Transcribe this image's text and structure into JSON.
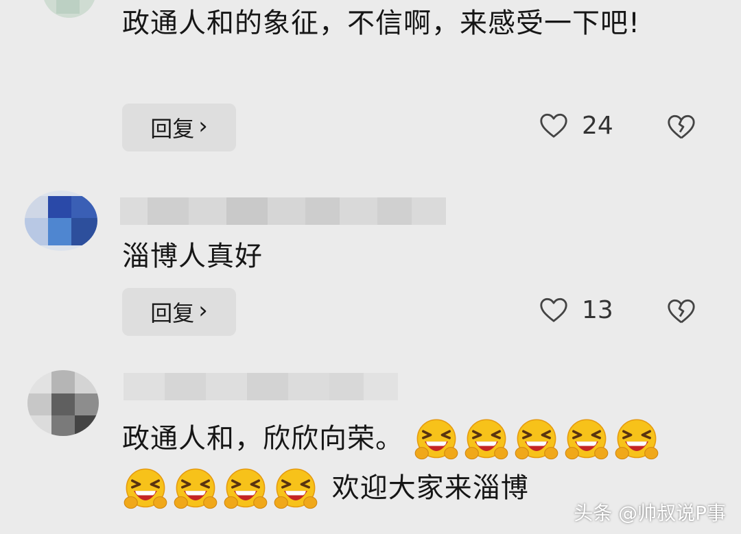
{
  "comments": [
    {
      "text": "政通人和的象征，不信啊，来感受一下吧!",
      "reply_label": "回复",
      "like_count": "24"
    },
    {
      "text": "淄博人真好",
      "reply_label": "回复",
      "like_count": "13"
    },
    {
      "text_part1": "政通人和，欣欣向荣。",
      "text_part2": "欢迎大家来淄博",
      "emoji_icon": "grinning-squinting-face-icon"
    }
  ],
  "icons": {
    "like": "heart-outline-icon",
    "dislike": "broken-heart-icon",
    "reply_arrow": "chevron-right-icon"
  },
  "watermark": "头条 @帅叔说P事",
  "colors": {
    "background": "#ebebeb",
    "button_bg": "#dedede",
    "text": "#161616",
    "icon": "#444444"
  }
}
